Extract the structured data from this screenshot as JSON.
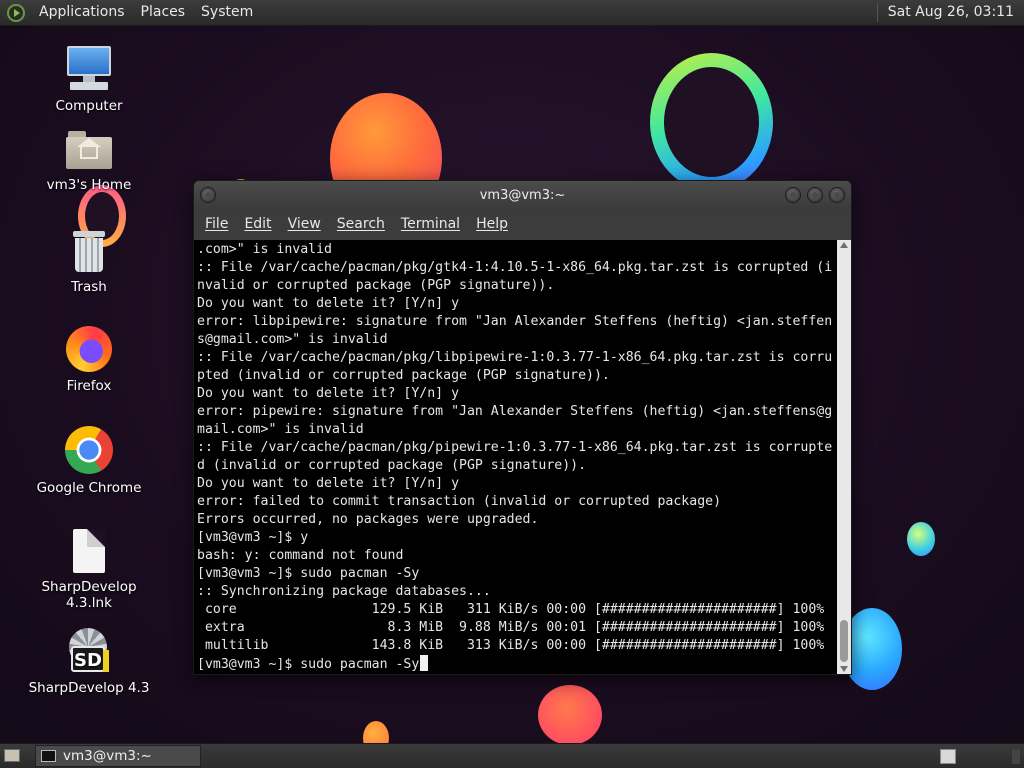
{
  "top_panel": {
    "menus": [
      "Applications",
      "Places",
      "System"
    ],
    "clock": "Sat Aug 26, 03:11"
  },
  "desktop_icons": [
    {
      "label": "Computer",
      "icon": "computer-icon"
    },
    {
      "label": "vm3's Home",
      "icon": "home-folder-icon"
    },
    {
      "label": "Trash",
      "icon": "trash-icon"
    },
    {
      "label": "Firefox",
      "icon": "firefox-icon"
    },
    {
      "label": "Google Chrome",
      "icon": "chrome-icon"
    },
    {
      "label": "SharpDevelop 4.3.lnk",
      "icon": "file-icon"
    },
    {
      "label": "SharpDevelop 4.3",
      "icon": "sharpdevelop-icon"
    }
  ],
  "terminal": {
    "title": "vm3@vm3:~",
    "menus": [
      "File",
      "Edit",
      "View",
      "Search",
      "Terminal",
      "Help"
    ],
    "lines": [
      ".com>\" is invalid",
      ":: File /var/cache/pacman/pkg/gtk4-1:4.10.5-1-x86_64.pkg.tar.zst is corrupted (i",
      "nvalid or corrupted package (PGP signature)).",
      "Do you want to delete it? [Y/n] y",
      "error: libpipewire: signature from \"Jan Alexander Steffens (heftig) <jan.steffen",
      "s@gmail.com>\" is invalid",
      ":: File /var/cache/pacman/pkg/libpipewire-1:0.3.77-1-x86_64.pkg.tar.zst is corru",
      "pted (invalid or corrupted package (PGP signature)).",
      "Do you want to delete it? [Y/n] y",
      "error: pipewire: signature from \"Jan Alexander Steffens (heftig) <jan.steffens@g",
      "mail.com>\" is invalid",
      ":: File /var/cache/pacman/pkg/pipewire-1:0.3.77-1-x86_64.pkg.tar.zst is corrupte",
      "d (invalid or corrupted package (PGP signature)).",
      "Do you want to delete it? [Y/n] y",
      "error: failed to commit transaction (invalid or corrupted package)",
      "Errors occurred, no packages were upgraded.",
      "[vm3@vm3 ~]$ y",
      "bash: y: command not found",
      "[vm3@vm3 ~]$ sudo pacman -Sy",
      ":: Synchronizing package databases...",
      " core                 129.5 KiB   311 KiB/s 00:00 [######################] 100%",
      " extra                  8.3 MiB  9.88 MiB/s 00:01 [######################] 100%",
      " multilib             143.8 KiB   313 KiB/s 00:00 [######################] 100%"
    ],
    "prompt_line": "[vm3@vm3 ~]$ sudo pacman -Sy"
  },
  "taskbar": {
    "task_label": "vm3@vm3:~"
  },
  "colors": {
    "terminal_bg": "#000000",
    "terminal_fg": "#e6e6e6",
    "panel_bg": "#2e2e2e"
  }
}
